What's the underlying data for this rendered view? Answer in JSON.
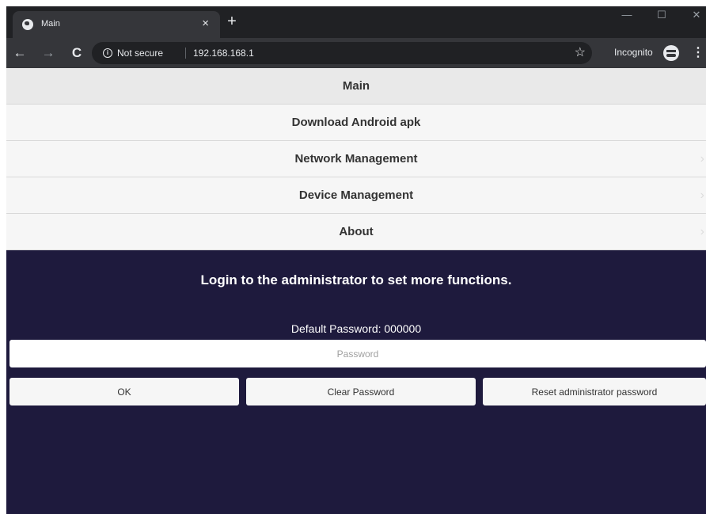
{
  "browser": {
    "tab_title": "Main",
    "tab_close": "×",
    "new_tab": "+",
    "window_controls": {
      "minimize": "—",
      "maximize": "☐",
      "close": "✕"
    },
    "nav": {
      "back": "←",
      "forward": "→",
      "reload": "C"
    },
    "security_text": "Not secure",
    "url": "192.168.168.1",
    "star": "☆",
    "incognito_label": "Incognito",
    "menu": "⋮"
  },
  "nav_menu": {
    "items": [
      {
        "label": "Main"
      },
      {
        "label": "Download Android apk"
      },
      {
        "label": "Network Management",
        "chevron": "›"
      },
      {
        "label": "Device Management",
        "chevron": "›"
      },
      {
        "label": "About",
        "chevron": "›"
      }
    ]
  },
  "login": {
    "title": "Login to the administrator to set more functions.",
    "default_password": "Default Password: 000000",
    "password_placeholder": "Password",
    "buttons": {
      "ok": "OK",
      "clear": "Clear Password",
      "reset": "Reset administrator password"
    }
  },
  "colors": {
    "page_background": "#1e1a3d",
    "menu_background": "#f6f6f6",
    "browser_dark": "#202124",
    "browser_toolbar": "#35363a"
  }
}
